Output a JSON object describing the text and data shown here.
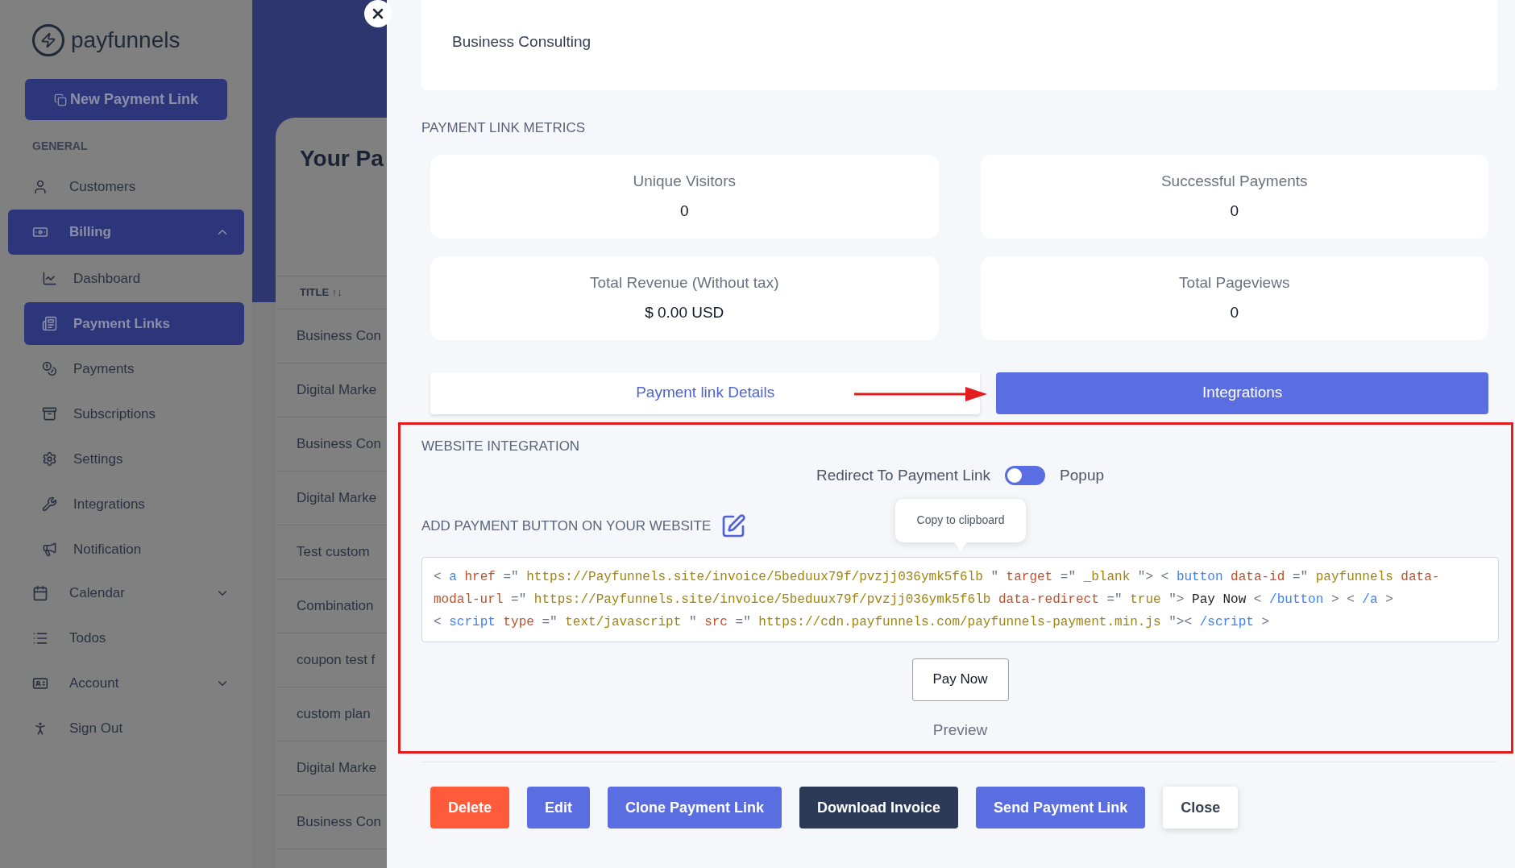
{
  "sidebar": {
    "logo": "payfunnels",
    "new_button": "New Payment Link",
    "section": "GENERAL",
    "items": [
      {
        "label": "Customers",
        "selected": false
      },
      {
        "label": "Billing",
        "selected": true,
        "expanded": true,
        "children": [
          {
            "label": "Dashboard",
            "selected": false
          },
          {
            "label": "Payment Links",
            "selected": true
          },
          {
            "label": "Payments",
            "selected": false
          },
          {
            "label": "Subscriptions",
            "selected": false
          },
          {
            "label": "Settings",
            "selected": false
          },
          {
            "label": "Integrations",
            "selected": false
          },
          {
            "label": "Notification",
            "selected": false
          }
        ]
      },
      {
        "label": "Calendar",
        "selected": false,
        "expanded": false
      },
      {
        "label": "Todos",
        "selected": false
      },
      {
        "label": "Account",
        "selected": false,
        "expanded": false
      },
      {
        "label": "Sign Out",
        "selected": false
      }
    ]
  },
  "main": {
    "title": "Your Pa",
    "column": "TITLE ↑↓",
    "rows": [
      "Business Con",
      "Digital Marke",
      "Business Con",
      "Digital Marke",
      "Test custom",
      "Combination",
      "coupon test f",
      "custom plan",
      "Digital Marke",
      "Business Con"
    ]
  },
  "modal": {
    "name": "Business Consulting",
    "metrics_title": "PAYMENT LINK METRICS",
    "metrics": [
      {
        "label": "Unique Visitors",
        "value": "0"
      },
      {
        "label": "Successful Payments",
        "value": "0"
      },
      {
        "label": "Total Revenue (Without tax)",
        "value": "$ 0.00 USD"
      },
      {
        "label": "Total Pageviews",
        "value": "0"
      }
    ],
    "tabs": [
      {
        "label": "Payment link Details",
        "selected": false
      },
      {
        "label": "Integrations",
        "selected": true
      }
    ],
    "integration": {
      "title": "WEBSITE INTEGRATION",
      "left_option": "Redirect To Payment Link",
      "popup_on": false,
      "right_option": "Popup",
      "add_title": "ADD PAYMENT BUTTON ON YOUR WEBSITE",
      "tooltip": "Copy to clipboard",
      "code": [
        [
          {
            "kind": "punct",
            "text": "<"
          },
          {
            "kind": "tag",
            "text": "a"
          },
          {
            "kind": "attr",
            "text": "href"
          },
          {
            "kind": "punct",
            "text": "=\""
          },
          {
            "kind": "value",
            "text": "https://Payfunnels.site/invoice/5beduux79f/pvzjj036ymk5f6lb"
          },
          {
            "kind": "punct",
            "text": "\""
          },
          {
            "kind": "attr",
            "text": "target"
          },
          {
            "kind": "punct",
            "text": "=\""
          },
          {
            "kind": "value",
            "text": "_blank"
          },
          {
            "kind": "punct",
            "text": "\">"
          },
          {
            "kind": "punct",
            "text": "<"
          },
          {
            "kind": "tag",
            "text": "button"
          },
          {
            "kind": "attr",
            "text": "data-id"
          },
          {
            "kind": "punct",
            "text": "=\""
          },
          {
            "kind": "value",
            "text": "payfunnels"
          },
          {
            "kind": "attr",
            "text": "data-"
          }
        ],
        [
          {
            "kind": "attr",
            "text": "modal-url"
          },
          {
            "kind": "punct",
            "text": "=\""
          },
          {
            "kind": "value",
            "text": "https://Payfunnels.site/invoice/5beduux79f/pvzjj036ymk5f6lb"
          },
          {
            "kind": "attr",
            "text": "data-redirect"
          },
          {
            "kind": "punct",
            "text": "=\""
          },
          {
            "kind": "value",
            "text": "true"
          },
          {
            "kind": "punct",
            "text": "\">"
          },
          {
            "kind": "text",
            "text": "Pay Now"
          },
          {
            "kind": "punct",
            "text": "<"
          },
          {
            "kind": "tag",
            "text": "/button"
          },
          {
            "kind": "punct",
            "text": ">"
          },
          {
            "kind": "punct",
            "text": "<"
          },
          {
            "kind": "tag",
            "text": "/a"
          },
          {
            "kind": "punct",
            "text": ">"
          }
        ],
        [
          {
            "kind": "punct",
            "text": "<"
          },
          {
            "kind": "tag",
            "text": "script"
          },
          {
            "kind": "attr",
            "text": "type"
          },
          {
            "kind": "punct",
            "text": "=\""
          },
          {
            "kind": "value",
            "text": "text/javascript"
          },
          {
            "kind": "punct",
            "text": "\""
          },
          {
            "kind": "attr",
            "text": "src"
          },
          {
            "kind": "punct",
            "text": "=\""
          },
          {
            "kind": "value",
            "text": "https://cdn.payfunnels.com/payfunnels-payment.min.js"
          },
          {
            "kind": "punct",
            "text": "\"><"
          },
          {
            "kind": "tag",
            "text": "/script"
          },
          {
            "kind": "punct",
            "text": ">"
          }
        ]
      ],
      "preview_button": "Pay Now",
      "preview_label": "Preview"
    },
    "buttons": [
      {
        "label": "Delete",
        "kind": "danger"
      },
      {
        "label": "Edit",
        "kind": "primary"
      },
      {
        "label": "Clone Payment Link",
        "kind": "primary"
      },
      {
        "label": "Download Invoice",
        "kind": "dark"
      },
      {
        "label": "Send Payment Link",
        "kind": "primary"
      },
      {
        "label": "Close",
        "kind": "light"
      }
    ]
  }
}
